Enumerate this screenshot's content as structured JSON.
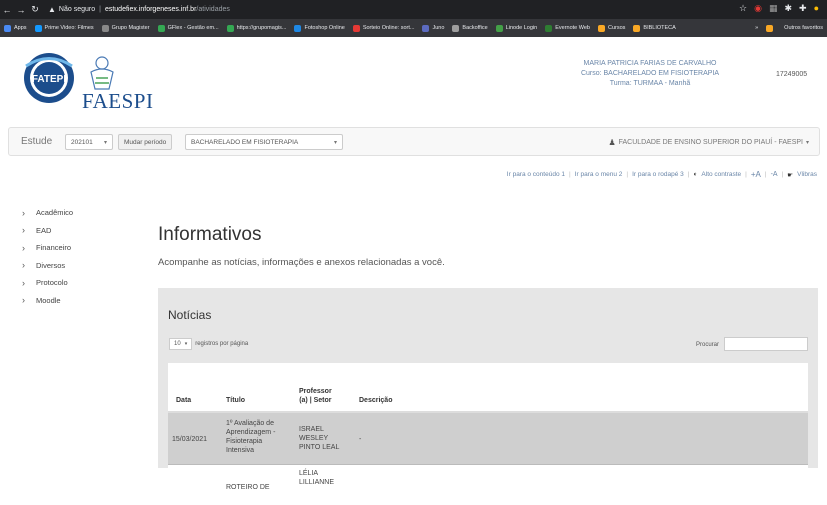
{
  "browser": {
    "security_label": "Não seguro",
    "url_host": "estudefiex.inforgeneses.inf.br",
    "url_path": "/atividades",
    "bookmarks": [
      {
        "label": "Apps",
        "color": "#4a8af4"
      },
      {
        "label": "Prime Video: Filmes",
        "color": "#1399ff"
      },
      {
        "label": "Grupo Magister",
        "color": "#888888"
      },
      {
        "label": "GFlex - Gestão em...",
        "color": "#34a853"
      },
      {
        "label": "https://grupomagis...",
        "color": "#34a853"
      },
      {
        "label": "Fotoshop Online",
        "color": "#1e88e5"
      },
      {
        "label": "Sorteio Online: sort...",
        "color": "#e53935"
      },
      {
        "label": "Juno",
        "color": "#5c6bc0"
      },
      {
        "label": "Backoffice",
        "color": "#9e9e9e"
      },
      {
        "label": "Linode Login",
        "color": "#43a047"
      },
      {
        "label": "Evernote Web",
        "color": "#2e7d32"
      },
      {
        "label": "Cursos",
        "color": "#f9a825"
      },
      {
        "label": "BIBLIOTECA",
        "color": "#f9a825"
      }
    ],
    "other_bookmarks": "Outros favoritos"
  },
  "header": {
    "logo_left": "FATEPI",
    "logo_right": "FAESPI",
    "user_name": "MARIA PATRICIA FARIAS DE CARVALHO",
    "course": "Curso: BACHARELADO EM FISIOTERAPIA",
    "class": "Turma: TURMAA - Manhã",
    "user_id": "17249005"
  },
  "navbar": {
    "brand": "Estude",
    "period": "202101",
    "change_period": "Mudar período",
    "course_select": "BACHARELADO EM FISIOTERAPIA",
    "faculty": "FACULDADE DE ENSINO SUPERIOR DO PIAUÍ - FAESPI"
  },
  "accessibility": {
    "skip_content": "Ir para o conteúdo 1",
    "skip_menu": "Ir para o menu 2",
    "skip_footer": "Ir para o rodapé 3",
    "contrast": "Alto contraste",
    "font_up": "+A",
    "font_down": "-A",
    "libras": "Vlibras"
  },
  "sidebar": {
    "items": [
      {
        "label": "Acadêmico"
      },
      {
        "label": "EAD"
      },
      {
        "label": "Financeiro"
      },
      {
        "label": "Diversos"
      },
      {
        "label": "Protocolo"
      },
      {
        "label": "Moodle"
      }
    ]
  },
  "main": {
    "title": "Informativos",
    "subtitle": "Acompanhe as notícias, informações e anexos relacionadas a você.",
    "panel_title": "Notícias",
    "page_length": "10",
    "page_length_label": "registros por página",
    "search_label": "Procurar",
    "columns": {
      "date": "Data",
      "title": "Título",
      "professor_line1": "Professor",
      "professor_line2": "(a) | Setor",
      "description": "Descrição"
    },
    "rows": [
      {
        "date": "15/03/2021",
        "title_lines": [
          "1º Avaliação de",
          "Aprendizagem -",
          "Fisioterapia",
          "Intensiva"
        ],
        "professor_lines": [
          "ISRAEL",
          "WESLEY",
          "PINTO LEAL"
        ],
        "description": "-"
      },
      {
        "date": "",
        "title_lines": [
          "ROTEIRO DE"
        ],
        "professor_lines": [
          "LÉLIA",
          "LILLIANNE"
        ],
        "description": ""
      }
    ]
  }
}
